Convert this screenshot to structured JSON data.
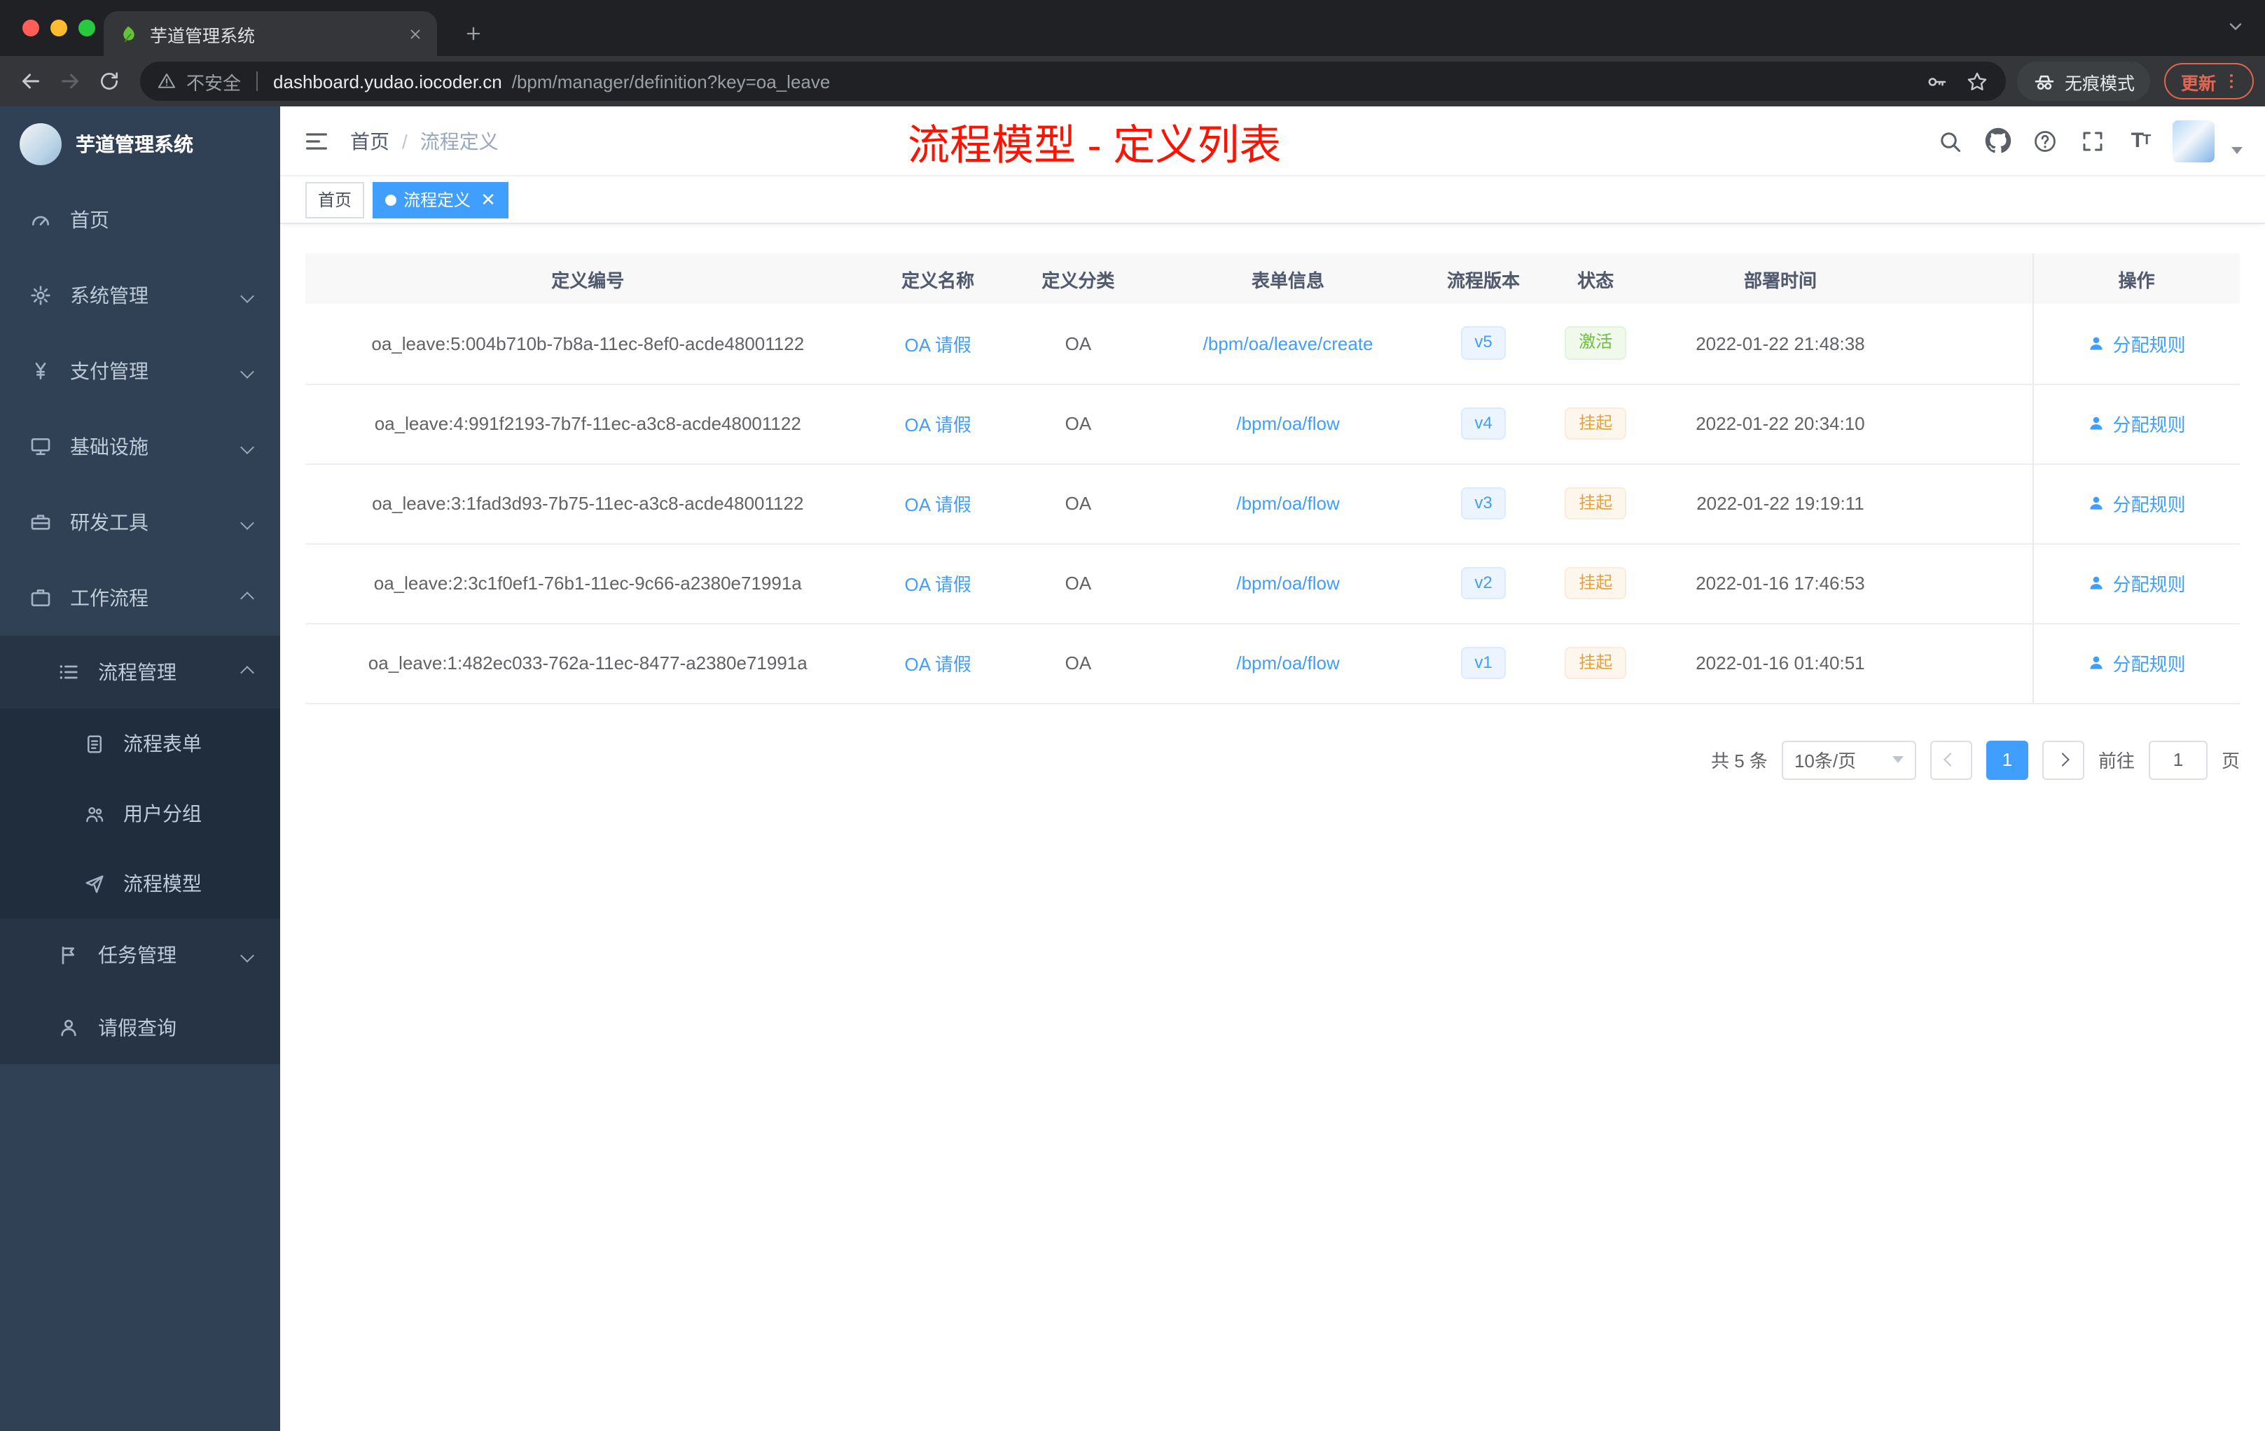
{
  "colors": {
    "accent": "#409eff",
    "annotation_red": "#fc1302",
    "status_active_green": "#67c23a",
    "status_suspend_yellow": "#e6a23c",
    "sidebar_bg": "#304156"
  },
  "browser": {
    "tab_title": "芋道管理系统",
    "security_label": "不安全",
    "url_host": "dashboard.yudao.iocoder.cn",
    "url_path": "/bpm/manager/definition?key=oa_leave",
    "incognito_label": "无痕模式",
    "update_label": "更新"
  },
  "sidebar": {
    "logo_title": "芋道管理系统",
    "items": [
      {
        "label": "首页"
      },
      {
        "label": "系统管理"
      },
      {
        "label": "支付管理"
      },
      {
        "label": "基础设施"
      },
      {
        "label": "研发工具"
      },
      {
        "label": "工作流程"
      },
      {
        "label": "流程管理"
      },
      {
        "label": "流程表单"
      },
      {
        "label": "用户分组"
      },
      {
        "label": "流程模型"
      },
      {
        "label": "任务管理"
      },
      {
        "label": "请假查询"
      }
    ]
  },
  "header": {
    "breadcrumb_home": "首页",
    "breadcrumb_separator": "/",
    "breadcrumb_current": "流程定义",
    "annotation": "流程模型 - 定义列表"
  },
  "tags": {
    "home": "首页",
    "active": "流程定义"
  },
  "table": {
    "columns": [
      "定义编号",
      "定义名称",
      "定义分类",
      "表单信息",
      "流程版本",
      "状态",
      "部署时间",
      "操作"
    ],
    "action_label": "分配规则",
    "rows": [
      {
        "id": "oa_leave:5:004b710b-7b8a-11ec-8ef0-acde48001122",
        "name": "OA 请假",
        "category": "OA",
        "form": "/bpm/oa/leave/create",
        "version": "v5",
        "status": "激活",
        "time": "2022-01-22 21:48:38"
      },
      {
        "id": "oa_leave:4:991f2193-7b7f-11ec-a3c8-acde48001122",
        "name": "OA 请假",
        "category": "OA",
        "form": "/bpm/oa/flow",
        "version": "v4",
        "status": "挂起",
        "time": "2022-01-22 20:34:10"
      },
      {
        "id": "oa_leave:3:1fad3d93-7b75-11ec-a3c8-acde48001122",
        "name": "OA 请假",
        "category": "OA",
        "form": "/bpm/oa/flow",
        "version": "v3",
        "status": "挂起",
        "time": "2022-01-22 19:19:11"
      },
      {
        "id": "oa_leave:2:3c1f0ef1-76b1-11ec-9c66-a2380e71991a",
        "name": "OA 请假",
        "category": "OA",
        "form": "/bpm/oa/flow",
        "version": "v2",
        "status": "挂起",
        "time": "2022-01-16 17:46:53"
      },
      {
        "id": "oa_leave:1:482ec033-762a-11ec-8477-a2380e71991a",
        "name": "OA 请假",
        "category": "OA",
        "form": "/bpm/oa/flow",
        "version": "v1",
        "status": "挂起",
        "time": "2022-01-16 01:40:51"
      }
    ]
  },
  "pagination": {
    "total": "共 5 条",
    "page_size": "10条/页",
    "current_page": "1",
    "goto_label": "前往",
    "goto_value": "1",
    "page_unit": "页"
  }
}
